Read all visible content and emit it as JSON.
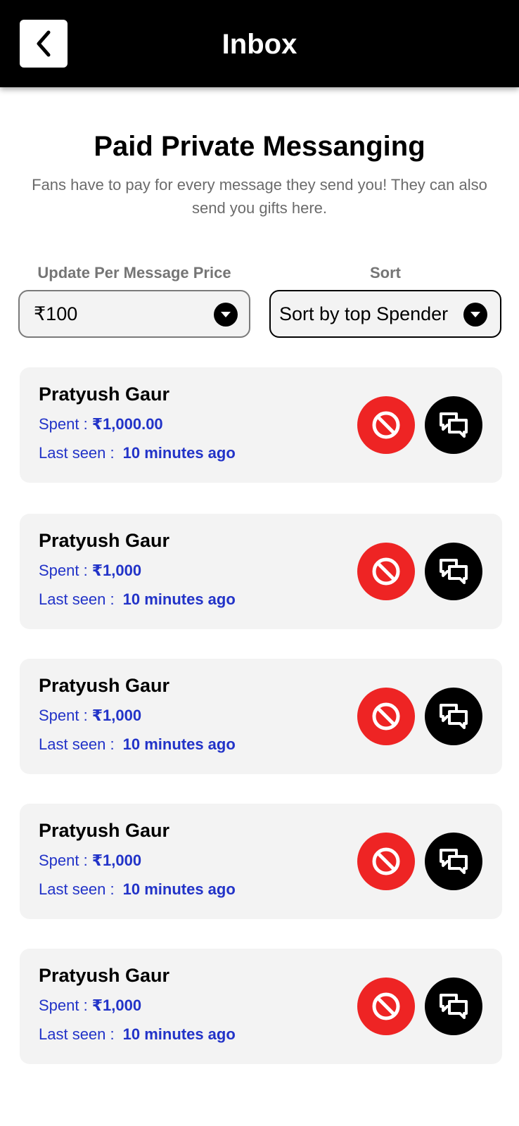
{
  "header": {
    "title": "Inbox",
    "back_icon": "chevron-left-icon"
  },
  "intro": {
    "title": "Paid Private Messanging",
    "subtitle": "Fans have to pay for every message they send you! They can also send you gifts here."
  },
  "price_select": {
    "label": "Update Per Message Price",
    "value": "₹100"
  },
  "sort_select": {
    "label": "Sort",
    "value": "Sort by top Spender"
  },
  "fan_list": [
    {
      "name": "Pratyush Gaur",
      "spent_label": "Spent :",
      "spent_value": "₹1,000.00",
      "last_seen_label": "Last seen :",
      "last_seen_value": "10 minutes ago"
    },
    {
      "name": "Pratyush Gaur",
      "spent_label": "Spent :",
      "spent_value": "₹1,000",
      "last_seen_label": "Last seen :",
      "last_seen_value": "10 minutes ago"
    },
    {
      "name": "Pratyush Gaur",
      "spent_label": "Spent :",
      "spent_value": "₹1,000",
      "last_seen_label": "Last seen :",
      "last_seen_value": "10 minutes ago"
    },
    {
      "name": "Pratyush Gaur",
      "spent_label": "Spent :",
      "spent_value": "₹1,000",
      "last_seen_label": "Last seen :",
      "last_seen_value": "10 minutes ago"
    },
    {
      "name": "Pratyush Gaur",
      "spent_label": "Spent :",
      "spent_value": "₹1,000",
      "last_seen_label": "Last seen :",
      "last_seen_value": "10 minutes ago"
    }
  ],
  "card_actions": {
    "block_icon": "block-icon",
    "chat_icon": "chat-bubbles-icon"
  },
  "colors": {
    "header_bg": "#000000",
    "accent_blue": "#2233c8",
    "block_red": "#ee2424",
    "card_bg": "#f3f3f3"
  }
}
